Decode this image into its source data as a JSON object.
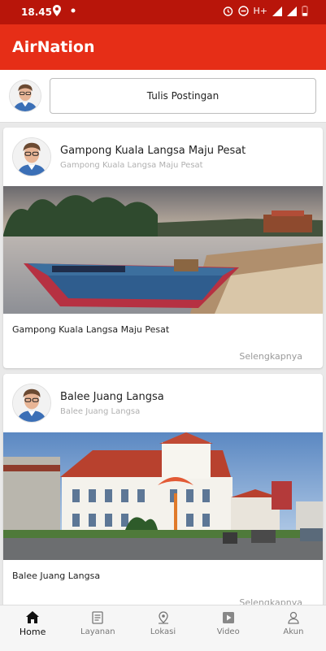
{
  "status_bar": {
    "time": "18.45",
    "network": "H+"
  },
  "app": {
    "title": "AirNation"
  },
  "compose": {
    "button_label": "Tulis Postingan"
  },
  "posts": [
    {
      "author": "Gampong Kuala Langsa Maju Pesat",
      "subtitle": "Gampong Kuala Langsa Maju Pesat",
      "caption": "Gampong Kuala Langsa Maju Pesat",
      "more_label": "Selengkapnya"
    },
    {
      "author": "Balee Juang Langsa",
      "subtitle": "Balee Juang Langsa",
      "caption": "Balee Juang Langsa",
      "more_label": "Selengkapnya"
    }
  ],
  "bottom_nav": {
    "items": [
      {
        "label": "Home",
        "icon": "home-icon",
        "active": true
      },
      {
        "label": "Layanan",
        "icon": "document-icon"
      },
      {
        "label": "Lokasi",
        "icon": "location-icon"
      },
      {
        "label": "Video",
        "icon": "play-icon"
      },
      {
        "label": "Akun",
        "icon": "person-icon"
      }
    ]
  },
  "colors": {
    "status_bar": "#b8150a",
    "app_bar": "#e62e17"
  }
}
